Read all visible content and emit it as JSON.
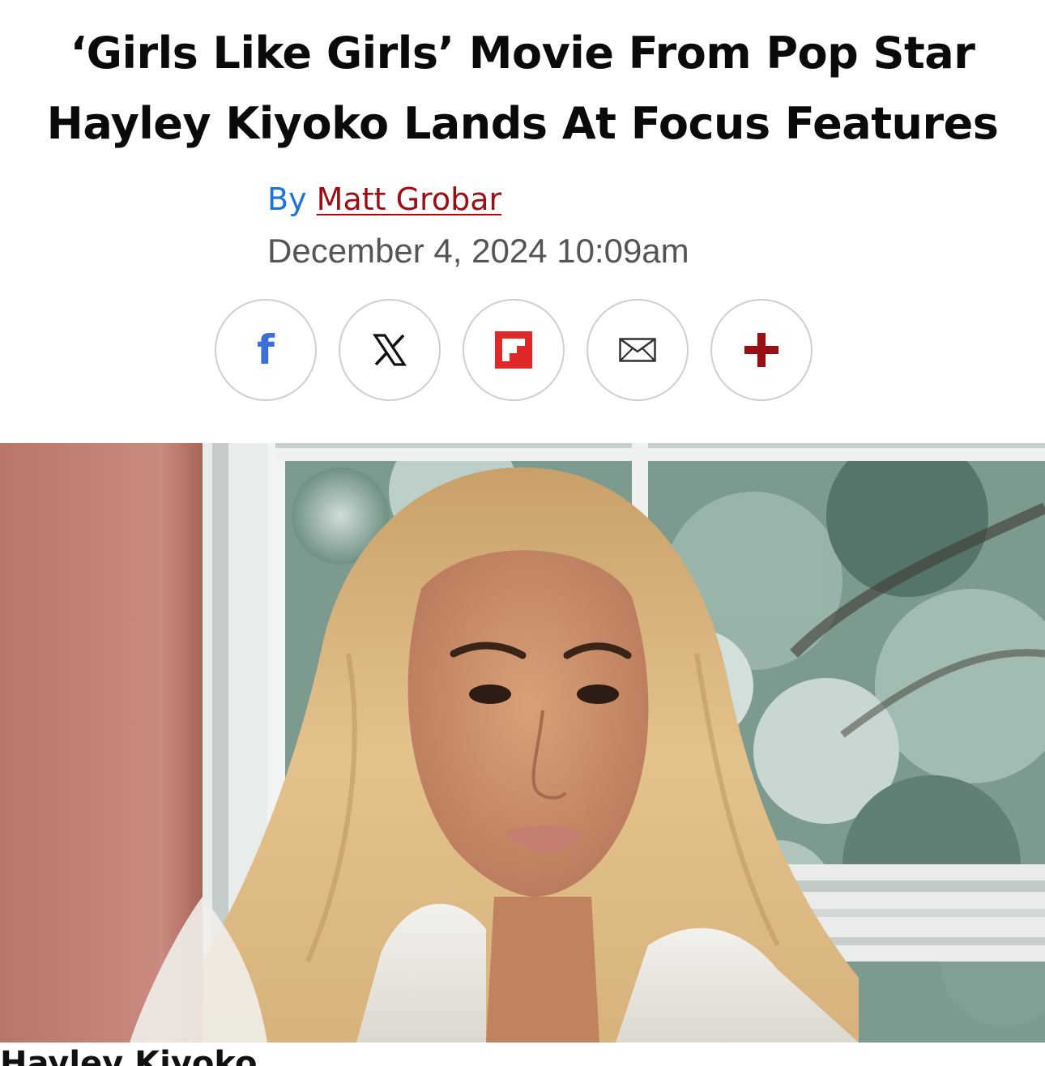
{
  "article": {
    "headline_line1": "‘Girls Like Girls’ Movie From Pop Star",
    "headline_line2": "Hayley Kiyoko Lands At Focus Features",
    "byline_prefix": "By",
    "author": "Matt Grobar",
    "timestamp": "December 4, 2024 10:09am",
    "caption_partial": "Hayley Kiyoko"
  },
  "share": {
    "buttons": [
      {
        "icon": "facebook-icon",
        "label": "f"
      },
      {
        "icon": "x-icon",
        "label": "𝕏"
      },
      {
        "icon": "flipboard-icon"
      },
      {
        "icon": "email-icon"
      },
      {
        "icon": "plus-icon"
      }
    ]
  },
  "colors": {
    "facebook": "#3b6fd4",
    "flipboard": "#e12828",
    "accent_red": "#9b0f14",
    "byline_blue": "#1f73d8",
    "date_gray": "#555555"
  },
  "hero_image": {
    "subject": "portrait photo of a woman with long blonde hair in front of a window with trees"
  }
}
